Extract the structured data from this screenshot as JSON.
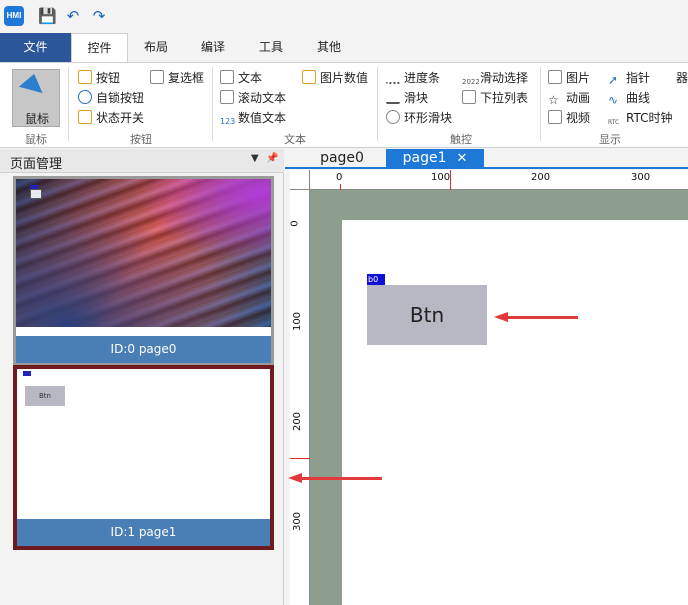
{
  "titlebar": {
    "logo": "HMI",
    "save_icon": "floppy-disk-icon",
    "undo_icon": "undo-icon",
    "redo_icon": "redo-icon"
  },
  "menu": {
    "tabs": [
      "文件",
      "控件",
      "布局",
      "编译",
      "工具",
      "其他"
    ],
    "active": "控件"
  },
  "ribbon": {
    "mouse_label": "鼠标",
    "groups": [
      {
        "label": "鼠标"
      },
      {
        "label": "按钮",
        "items": [
          "按钮",
          "复选框",
          "自锁按钮",
          "状态开关"
        ]
      },
      {
        "label": "文本",
        "items": [
          "文本",
          "图片数值",
          "滚动文本",
          "数值文本"
        ]
      },
      {
        "label": "触控",
        "items": [
          "进度条",
          "滑动选择",
          "滑块",
          "下拉列表",
          "环形滑块"
        ]
      },
      {
        "label": "显示",
        "items": [
          "图片",
          "指针",
          "动画",
          "曲线",
          "视频",
          "RTC时钟"
        ]
      }
    ],
    "overflow_text": "器"
  },
  "left_panel": {
    "title": "页面管理",
    "pages": [
      {
        "caption": "ID:0 page0"
      },
      {
        "caption": "ID:1 page1",
        "mini_button": "Btn"
      }
    ]
  },
  "doc_tabs": {
    "tabs": [
      "page0",
      "page1"
    ],
    "active": "page1",
    "close": "✕"
  },
  "rulers": {
    "h_labels": [
      "0",
      "100",
      "200",
      "300"
    ],
    "v_labels": [
      "0",
      "100",
      "200",
      "300"
    ]
  },
  "canvas": {
    "component_tag": "b0",
    "component_label": "Btn"
  },
  "colors": {
    "accent": "#1e78d7",
    "file_tab": "#2b579a",
    "selection": "#6e1a1f",
    "arrow": "#e23a3a",
    "canvas_bg": "#8e9e8e"
  }
}
